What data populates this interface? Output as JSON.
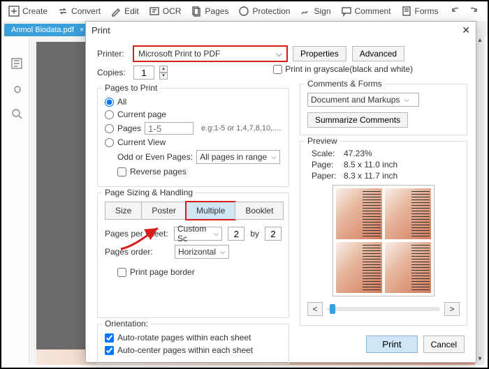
{
  "toolbar": {
    "items": [
      "Create",
      "Convert",
      "Edit",
      "OCR",
      "Pages",
      "Protection",
      "Sign",
      "Comment",
      "Forms"
    ]
  },
  "tab": {
    "filename": "Anmol Biodata.pdf"
  },
  "dialog": {
    "title": "Print",
    "printer_label": "Printer:",
    "printer_value": "Microsoft Print to PDF",
    "properties_btn": "Properties",
    "advanced_btn": "Advanced",
    "copies_label": "Copies:",
    "copies_value": "1",
    "grayscale_label": "Print in grayscale(black and white)",
    "pages_to_print": {
      "legend": "Pages to Print",
      "all": "All",
      "current_page": "Current page",
      "pages": "Pages",
      "pages_placeholder": "1-5",
      "pages_hint": "e.g:1-5 or 1,4,7,8,10,....",
      "current_view": "Current View",
      "odd_even_label": "Odd or Even Pages:",
      "odd_even_value": "All pages in range",
      "reverse": "Reverse pages"
    },
    "sizing": {
      "legend": "Page Sizing & Handling",
      "size": "Size",
      "poster": "Poster",
      "multiple": "Multiple",
      "booklet": "Booklet",
      "pps_label": "Pages per sheet:",
      "pps_mode": "Custom Sc",
      "pps_cols": "2",
      "pps_by": "by",
      "pps_rows": "2",
      "order_label": "Pages order:",
      "order_value": "Horizontal",
      "border": "Print page border"
    },
    "comments": {
      "legend": "Comments & Forms",
      "value": "Document and Markups",
      "summarize": "Summarize Comments"
    },
    "preview": {
      "legend": "Preview",
      "scale_k": "Scale:",
      "scale_v": "47.23%",
      "page_k": "Page:",
      "page_v": "8.5 x 11.0 inch",
      "paper_k": "Paper:",
      "paper_v": "8.3 x 11.7 inch"
    },
    "orientation": {
      "legend": "Orientation:",
      "auto_rotate": "Auto-rotate pages within each sheet",
      "auto_center": "Auto-center pages within each sheet"
    },
    "print_btn": "Print",
    "cancel_btn": "Cancel"
  }
}
